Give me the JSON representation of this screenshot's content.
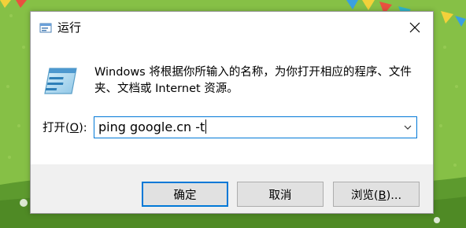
{
  "window": {
    "title": "运行",
    "icon": "run-app-icon",
    "close_icon": "close-icon"
  },
  "content": {
    "icon": "run-dialog-icon",
    "description": "Windows 将根据你所输入的名称，为你打开相应的程序、文件夹、文档或 Internet 资源。"
  },
  "open_field": {
    "label_prefix": "打开(",
    "label_access_key": "O",
    "label_suffix": "):",
    "value": "ping google.cn -t",
    "dropdown_icon": "chevron-down-icon"
  },
  "buttons": {
    "ok": "确定",
    "cancel": "取消",
    "browse_prefix": "浏览(",
    "browse_access_key": "B",
    "browse_suffix": ")..."
  },
  "colors": {
    "accent": "#0078d7",
    "dialog_bg": "#f0f0f0",
    "content_bg": "#ffffff",
    "wallpaper_green": "#7fbc3f"
  }
}
